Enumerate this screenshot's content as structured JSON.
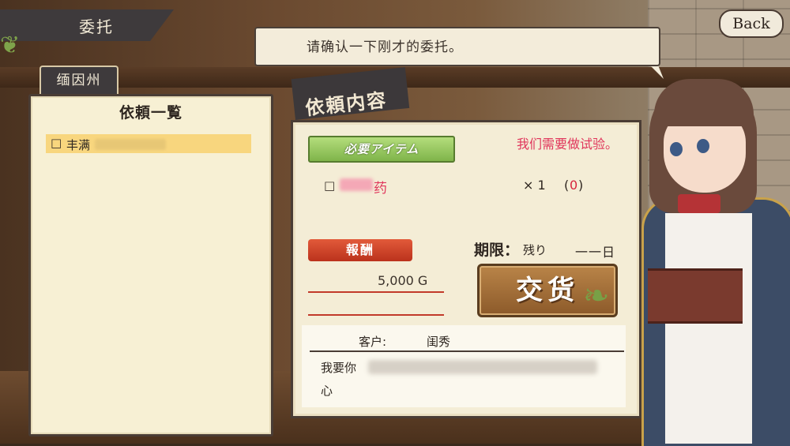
{
  "header": {
    "title": "委托"
  },
  "back_button": {
    "label": "Back"
  },
  "speech": {
    "text": "请确认一下刚才的委托。"
  },
  "location": {
    "label": "缅因州"
  },
  "quest_list": {
    "title": "依頼一覧",
    "items": [
      {
        "checkbox": "□",
        "label": "丰满"
      }
    ]
  },
  "detail": {
    "header": "依頼内容",
    "required_items_label": "必要アイテム",
    "note": "我们需要做试验。",
    "item": {
      "checkbox": "□",
      "name": "药",
      "qty": "× 1",
      "have_open": "(",
      "have": "0",
      "have_close": ")"
    },
    "reward_label": "報酬",
    "reward_value": "5,000 G",
    "deadline_label": "期限：",
    "deadline_remaining": "残り",
    "deadline_days": "一一日",
    "deliver_button": "交货",
    "client_label": "客户:",
    "client_name": "闺秀",
    "description_line1": "我要你",
    "description_line2": "心"
  },
  "colors": {
    "accent_green": "#7fb44a",
    "reward_red": "#bb321c",
    "note_pink": "#e0355b",
    "highlight_yellow": "#f8d67e",
    "deliver_brown": "#8c5a2a"
  },
  "icons": {
    "vine_left": "vine-ornament-icon",
    "vine_button": "vine-ornament-icon"
  }
}
